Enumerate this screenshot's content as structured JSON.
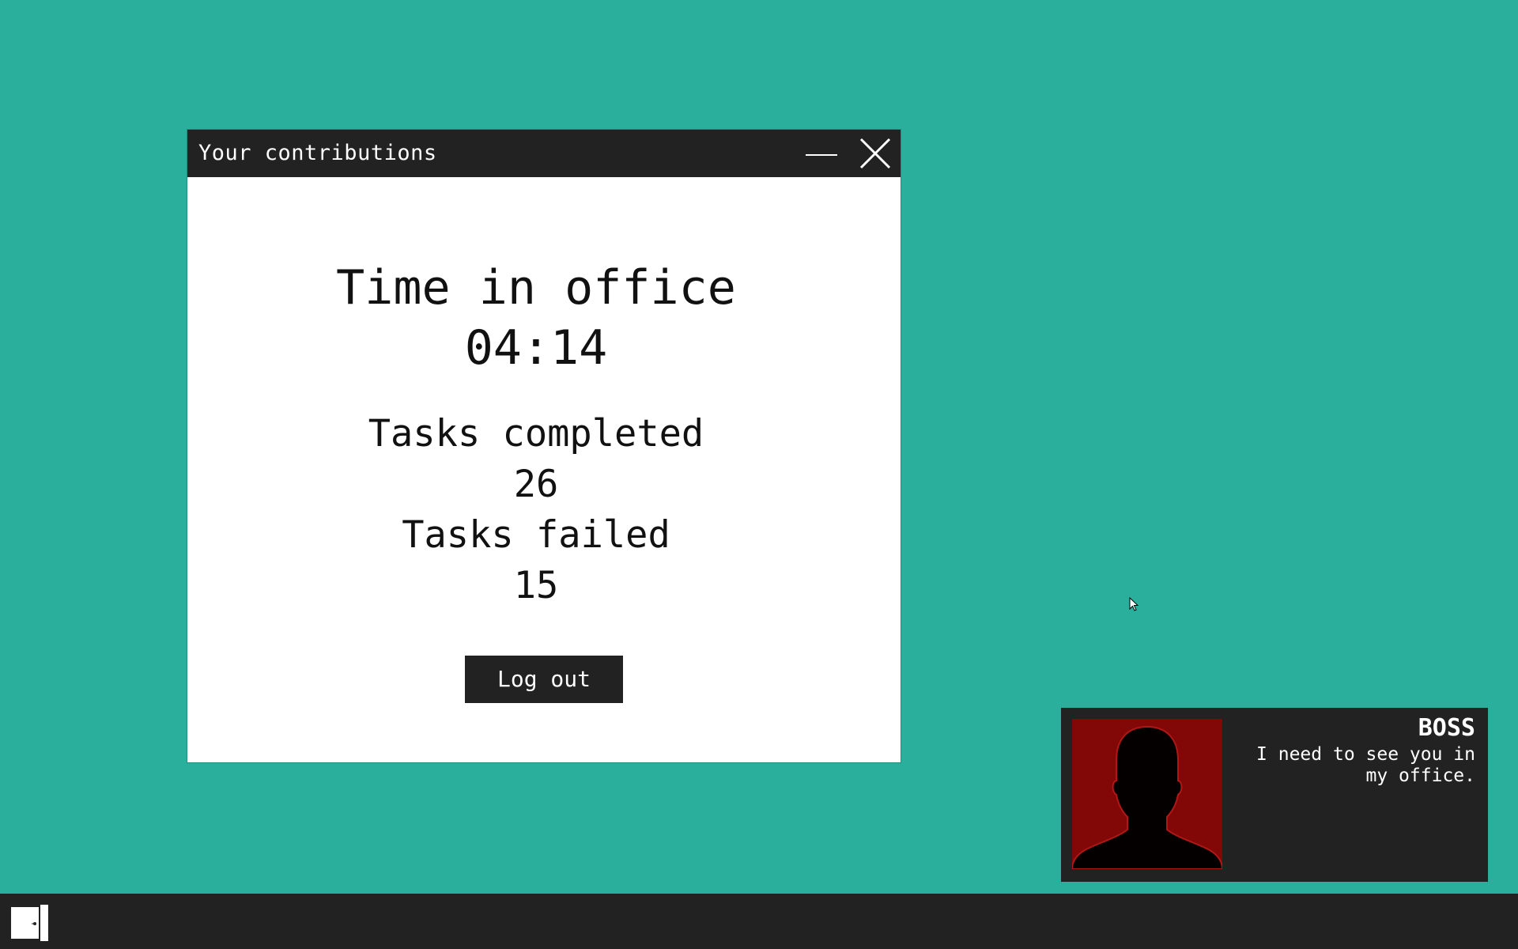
{
  "window": {
    "title": "Your contributions",
    "time_label": "Time in office",
    "time_value": "04:14",
    "completed_label": "Tasks completed",
    "completed_value": "26",
    "failed_label": "Tasks failed",
    "failed_value": "15",
    "logout_label": "Log out"
  },
  "notification": {
    "sender": "BOSS",
    "message": "I need to see you in my office.",
    "avatar_icon": "person-silhouette-icon"
  },
  "taskbar": {
    "start_icon": "door-icon"
  },
  "colors": {
    "desktop": "#2aaf9c",
    "dark": "#222222",
    "avatar_bg": "#820808"
  }
}
